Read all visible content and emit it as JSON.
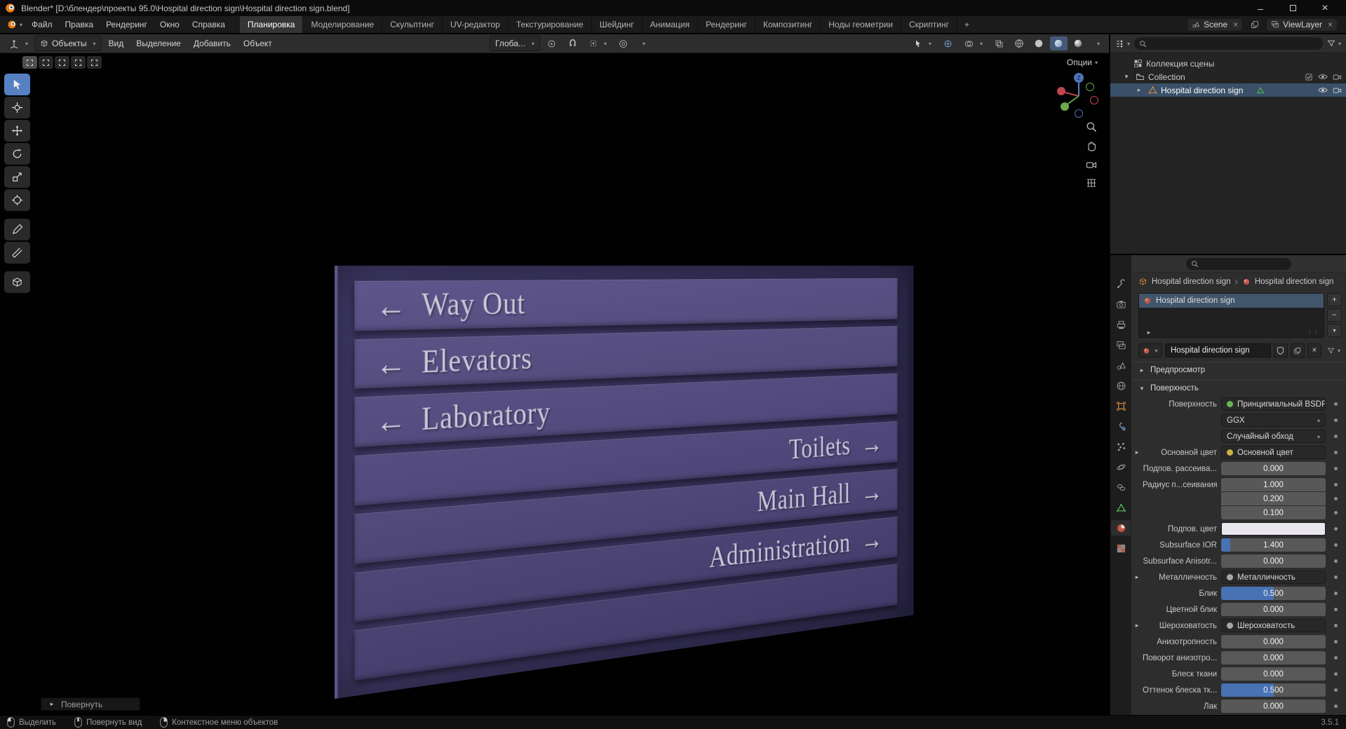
{
  "colors": {
    "accent": "#4772b3",
    "selection_highlight": "#3a5068",
    "active_tool": "#5680c2",
    "sign_panel": "#544c7c",
    "sign_text": "#d6cfe0"
  },
  "titlebar": {
    "title": "Blender* [D:\\блендер\\проекты 95.0\\Hospital direction sign\\Hospital direction sign.blend]"
  },
  "menubar": {
    "menus": [
      "Файл",
      "Правка",
      "Рендеринг",
      "Окно",
      "Справка"
    ],
    "workspaces": [
      "Планировка",
      "Моделирование",
      "Скульптинг",
      "UV-редактор",
      "Текстурирование",
      "Шейдинг",
      "Анимация",
      "Рендеринг",
      "Композитинг",
      "Ноды геометрии",
      "Скриптинг"
    ],
    "add_workspace": "+",
    "scene": "Scene",
    "view_layer": "ViewLayer"
  },
  "viewport": {
    "mode": "Объекты",
    "menus": [
      "Вид",
      "Выделение",
      "Добавить",
      "Объект"
    ],
    "orientation": "Глоба...",
    "options": "Опции",
    "redo_panel": "Повернуть"
  },
  "sign": {
    "rows": [
      {
        "arrow": "←",
        "text": "Way Out"
      },
      {
        "arrow": "←",
        "text": "Elevators"
      },
      {
        "arrow": "←",
        "text": "Laboratory"
      },
      {
        "arrow": "→",
        "text": "Toilets"
      },
      {
        "arrow": "→",
        "text": "Main Hall"
      },
      {
        "arrow": "→",
        "text": "Administration"
      },
      {
        "arrow": "",
        "text": ""
      }
    ]
  },
  "outliner": {
    "scene_collection": "Коллекция сцены",
    "collection": "Collection",
    "object_name": "Hospital direction sign"
  },
  "properties": {
    "breadcrumb_object": "Hospital direction sign",
    "breadcrumb_material": "Hospital direction sign",
    "slot_name": "Hospital direction sign",
    "material_name": "Hospital direction sign",
    "panel_preview": "Предпросмотр",
    "panel_surface": "Поверхность",
    "surface": {
      "rows": [
        {
          "label": "Поверхность",
          "value": "Принципиальный BSDF"
        },
        {
          "label": "",
          "value": "GGX"
        },
        {
          "label": "",
          "value": "Случайный обход"
        },
        {
          "label": "Основной цвет",
          "value": "Основной цвет"
        },
        {
          "label": "Подпов. рассеива...",
          "value": "0.000",
          "fill": 0
        },
        {
          "label": "Радиус п...сеивания",
          "value": "1.000"
        },
        {
          "label": "",
          "value": "0.200"
        },
        {
          "label": "",
          "value": "0.100"
        },
        {
          "label": "Подпов. цвет",
          "value": "",
          "swatch": "#e9e6ee"
        },
        {
          "label": "Subsurface IOR",
          "value": "1.400",
          "fill": 9
        },
        {
          "label": "Subsurface Anisotr...",
          "value": "0.000",
          "fill": 0
        },
        {
          "label": "Металличность",
          "value": "Металличность"
        },
        {
          "label": "Блик",
          "value": "0.500",
          "fill": 50
        },
        {
          "label": "Цветной блик",
          "value": "0.000",
          "fill": 0
        },
        {
          "label": "Шероховатость",
          "value": "Шероховатость"
        },
        {
          "label": "Анизотропность",
          "value": "0.000",
          "fill": 0
        },
        {
          "label": "Поворот анизотро...",
          "value": "0.000",
          "fill": 0
        },
        {
          "label": "Блеск ткани",
          "value": "0.000",
          "fill": 0
        },
        {
          "label": "Оттенок блеска тк...",
          "value": "0.500",
          "fill": 50
        },
        {
          "label": "Лак",
          "value": "0.000",
          "fill": 0
        }
      ]
    }
  },
  "statusbar": {
    "left": "Выделить",
    "middle": "Повернуть вид",
    "right": "Контекстное меню объектов",
    "version": "3.5.1"
  }
}
